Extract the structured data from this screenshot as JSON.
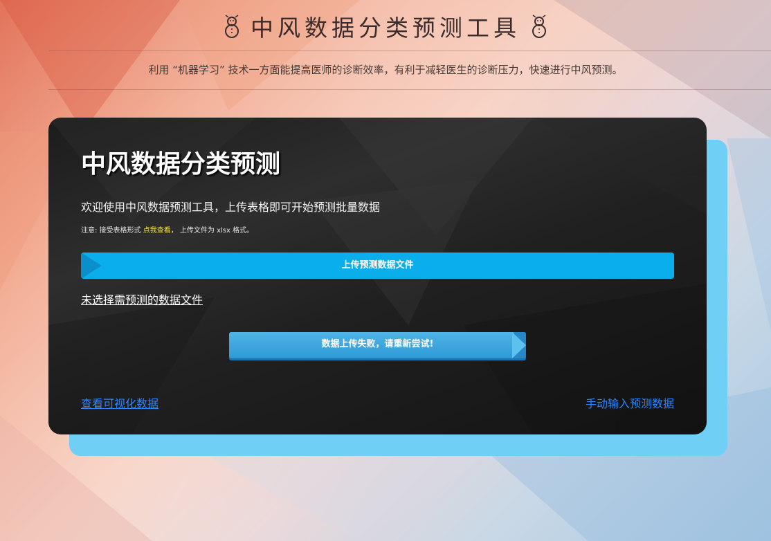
{
  "header": {
    "title": "中风数据分类预测工具",
    "icon_left": "snowman-icon",
    "icon_right": "snowman-icon",
    "subtitle": "利用 “机器学习” 技术一方面能提高医师的诊断效率，有利于减轻医生的诊断压力，快速进行中风预测。"
  },
  "card": {
    "title": "中风数据分类预测",
    "welcome": "欢迎使用中风数据预测工具，上传表格即可开始预测批量数据",
    "note_prefix": "注意: 接受表格形式",
    "note_link": "点我查看",
    "note_suffix": "， 上传文件为 xlsx 格式。",
    "upload_label": "上传预测数据文件",
    "no_file_text": "未选择需预测的数据文件",
    "status_label": "数据上传失败，请重新尝试!",
    "link_visualize": "查看可视化数据",
    "link_manual": "手动输入预测数据"
  },
  "colors": {
    "accent_blue": "#0aaeea",
    "link_blue": "#2b86ff",
    "note_highlight": "#f5e03a",
    "back_card": "#6fcff5"
  }
}
